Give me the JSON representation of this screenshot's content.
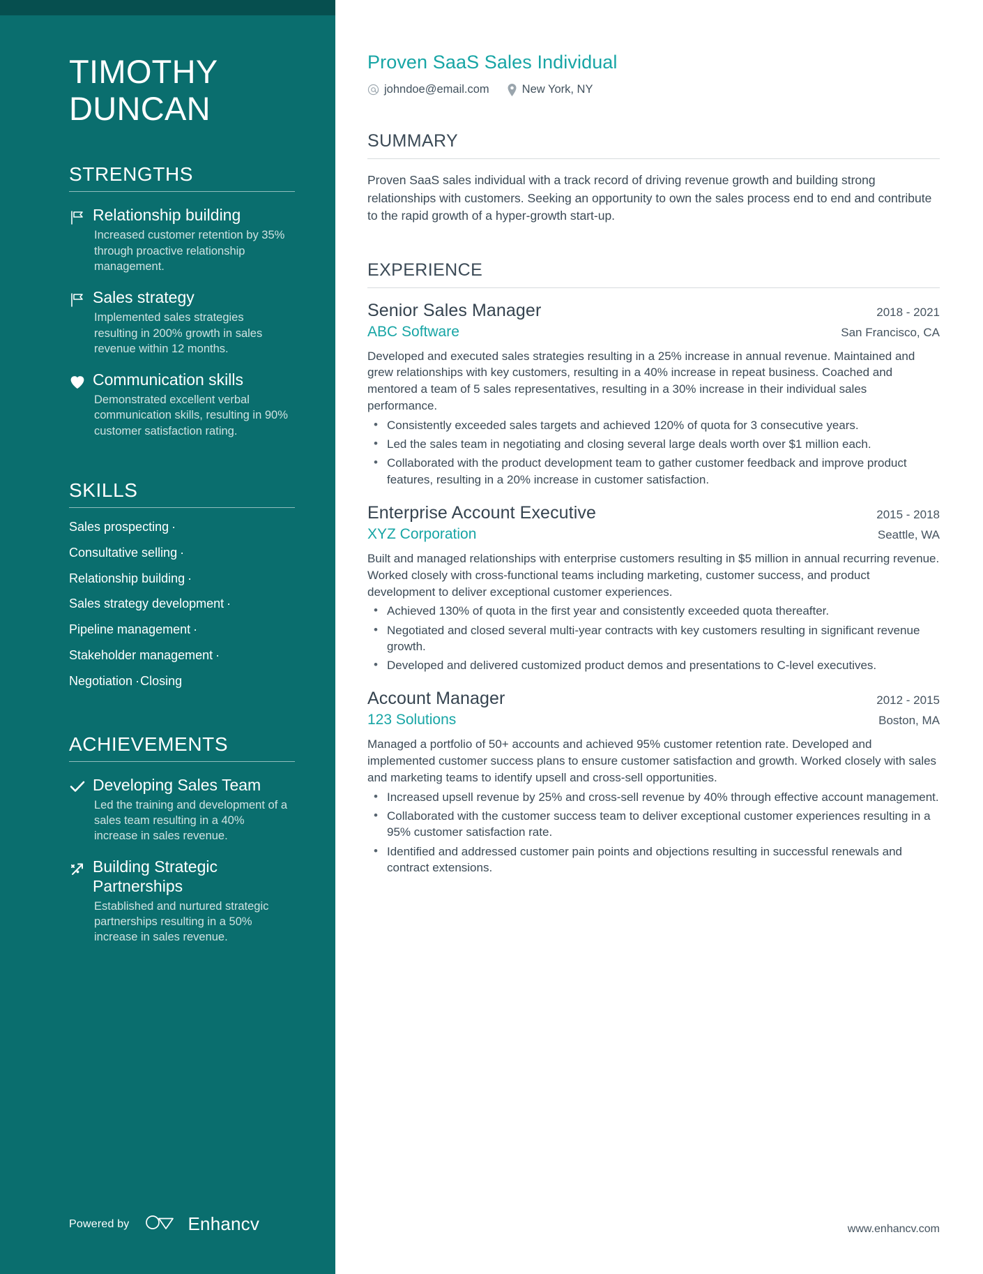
{
  "theme": {
    "sidebar_bg": "#0a6e6e",
    "sidebar_topbar_bg": "#064f4f",
    "accent": "#17a5a5",
    "text_dark": "#3b4a56",
    "sidebar_muted": "#cfe2e1"
  },
  "sidebar": {
    "name_line1": "TIMOTHY",
    "name_line2": "DUNCAN",
    "strengths": {
      "heading": "STRENGTHS",
      "items": [
        {
          "icon": "flag-icon",
          "title": "Relationship building",
          "description": "Increased customer retention by 35% through proactive relationship management."
        },
        {
          "icon": "flag-icon",
          "title": "Sales strategy",
          "description": "Implemented sales strategies resulting in 200% growth in sales revenue within 12 months."
        },
        {
          "icon": "heart-icon",
          "title": "Communication skills",
          "description": "Demonstrated excellent verbal communication skills, resulting in 90% customer satisfaction rating."
        }
      ]
    },
    "skills": {
      "heading": "SKILLS",
      "items": [
        "Sales prospecting",
        "Consultative selling",
        "Relationship building",
        "Sales strategy development",
        "Pipeline management",
        "Stakeholder management",
        "Negotiation",
        "Closing"
      ],
      "lines": [
        [
          "Sales prospecting"
        ],
        [
          "Consultative selling"
        ],
        [
          "Relationship building"
        ],
        [
          "Sales strategy development"
        ],
        [
          "Pipeline management"
        ],
        [
          "Stakeholder management"
        ],
        [
          "Negotiation",
          "Closing"
        ]
      ],
      "separator": "·"
    },
    "achievements": {
      "heading": "ACHIEVEMENTS",
      "items": [
        {
          "icon": "check-icon",
          "title": "Developing Sales Team",
          "description": "Led the training and development of a sales team resulting in a 40% increase in sales revenue."
        },
        {
          "icon": "rocket-icon",
          "title": "Building Strategic Partnerships",
          "description": "Established and nurtured strategic partnerships resulting in a 50% increase in sales revenue."
        }
      ]
    },
    "footer": {
      "powered_by_label": "Powered by",
      "brand_name": "Enhancv",
      "brand_icon": "enhancv-logo-icon"
    }
  },
  "main": {
    "headline": "Proven SaaS Sales Individual",
    "contact": [
      {
        "icon": "at-icon",
        "value": "johndoe@email.com"
      },
      {
        "icon": "location-pin-icon",
        "value": "New York, NY"
      }
    ],
    "summary": {
      "heading": "SUMMARY",
      "text": "Proven SaaS sales individual with a track record of driving revenue growth and building strong relationships with customers. Seeking an opportunity to own the sales process end to end and contribute to the rapid growth of a hyper-growth start-up."
    },
    "experience": {
      "heading": "EXPERIENCE",
      "jobs": [
        {
          "title": "Senior Sales Manager",
          "dates": "2018 - 2021",
          "company": "ABC Software",
          "location": "San Francisco, CA",
          "description": "Developed and executed sales strategies resulting in a 25% increase in annual revenue. Maintained and grew relationships with key customers, resulting in a 40% increase in repeat business. Coached and mentored a team of 5 sales representatives, resulting in a 30% increase in their individual sales performance.",
          "bullets": [
            "Consistently exceeded sales targets and achieved 120% of quota for 3 consecutive years.",
            "Led the sales team in negotiating and closing several large deals worth over $1 million each.",
            "Collaborated with the product development team to gather customer feedback and improve product features, resulting in a 20% increase in customer satisfaction."
          ]
        },
        {
          "title": "Enterprise Account Executive",
          "dates": "2015 - 2018",
          "company": "XYZ Corporation",
          "location": "Seattle, WA",
          "description": "Built and managed relationships with enterprise customers resulting in $5 million in annual recurring revenue. Worked closely with cross-functional teams including marketing, customer success, and product development to deliver exceptional customer experiences.",
          "bullets": [
            "Achieved 130% of quota in the first year and consistently exceeded quota thereafter.",
            "Negotiated and closed several multi-year contracts with key customers resulting in significant revenue growth.",
            "Developed and delivered customized product demos and presentations to C-level executives."
          ]
        },
        {
          "title": "Account Manager",
          "dates": "2012 - 2015",
          "company": "123 Solutions",
          "location": "Boston, MA",
          "description": "Managed a portfolio of 50+ accounts and achieved 95% customer retention rate. Developed and implemented customer success plans to ensure customer satisfaction and growth. Worked closely with sales and marketing teams to identify upsell and cross-sell opportunities.",
          "bullets": [
            "Increased upsell revenue by 25% and cross-sell revenue by 40% through effective account management.",
            "Collaborated with the customer success team to deliver exceptional customer experiences resulting in a 95% customer satisfaction rate.",
            "Identified and addressed customer pain points and objections resulting in successful renewals and contract extensions."
          ]
        }
      ]
    },
    "footer": {
      "website": "www.enhancv.com"
    }
  }
}
